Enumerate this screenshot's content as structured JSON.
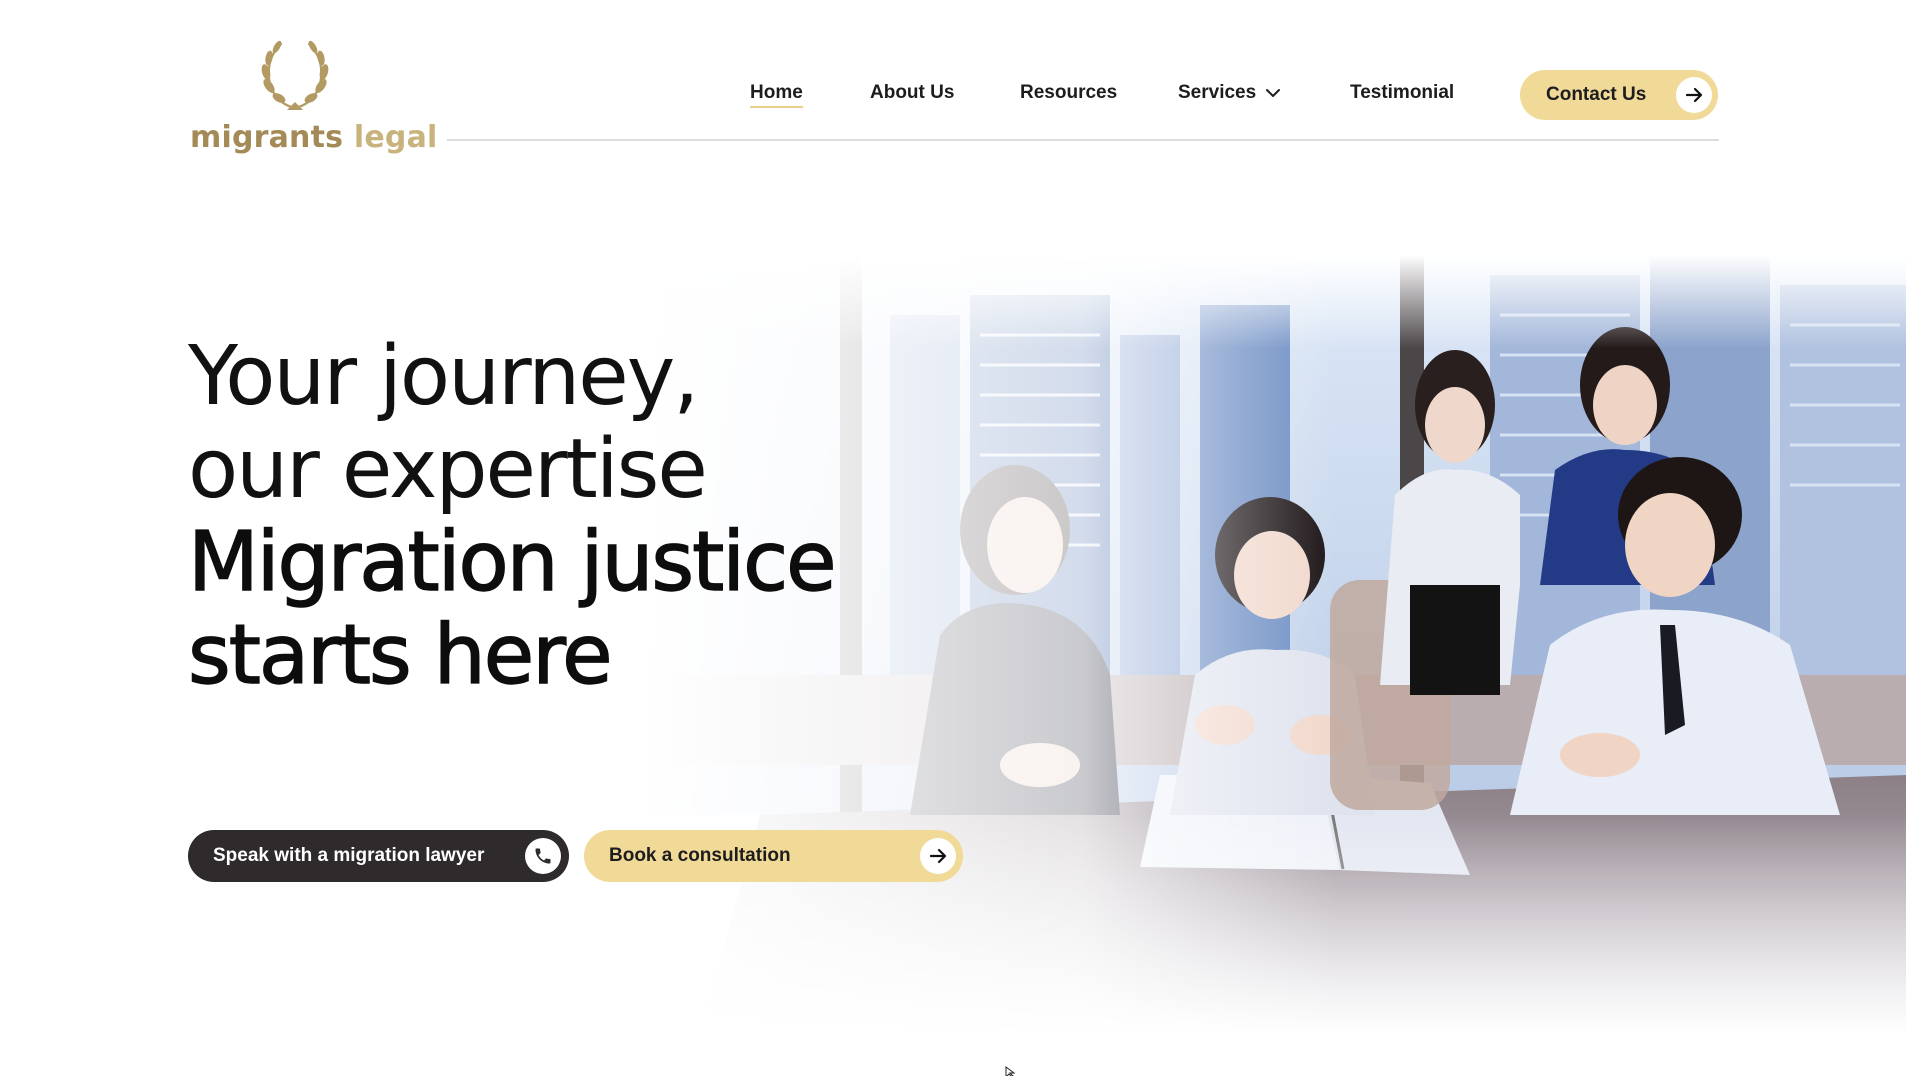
{
  "brand": {
    "name_part1": "migrants",
    "name_part2": "legal",
    "logo_icon": "laurel-wreath-icon",
    "colors": {
      "gold_dark": "#a38a56",
      "gold_light": "#c9b37d",
      "accent": "#f1d998",
      "dark": "#2f2a2b"
    }
  },
  "nav": {
    "items": [
      {
        "label": "Home",
        "active": true
      },
      {
        "label": "About Us"
      },
      {
        "label": "Resources"
      },
      {
        "label": "Services",
        "icon": "chevron-down-icon"
      },
      {
        "label": "Testimonial"
      }
    ],
    "contact": {
      "label": "Contact Us",
      "icon": "arrow-right-icon"
    }
  },
  "hero": {
    "line1": "Your journey,",
    "line2": "our expertise",
    "line3": "Migration justice",
    "line4": "starts here",
    "cta_primary": {
      "label": "Speak with a migration lawyer",
      "icon": "phone-icon"
    },
    "cta_secondary": {
      "label": "Book a consultation",
      "icon": "arrow-right-icon"
    }
  }
}
